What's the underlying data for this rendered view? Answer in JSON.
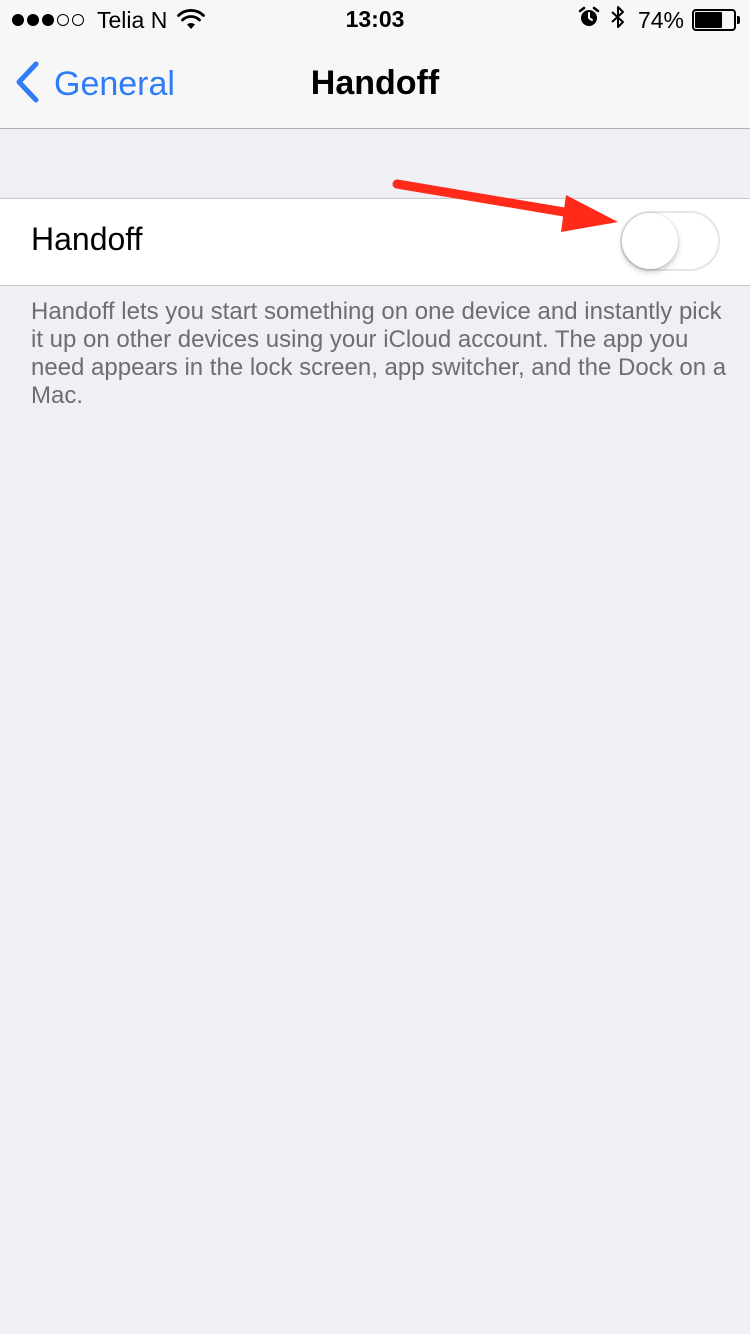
{
  "status_bar": {
    "signal_strength": "3/5",
    "carrier": "Telia N",
    "time": "13:03",
    "battery_percent": "74%",
    "battery_level": 0.74,
    "icons": [
      "wifi-icon",
      "alarm-icon",
      "bluetooth-icon",
      "battery-icon"
    ]
  },
  "nav": {
    "back_label": "General",
    "title": "Handoff"
  },
  "settings": {
    "handoff_label": "Handoff",
    "handoff_enabled": false
  },
  "footer": {
    "description": "Handoff lets you start something on one device and instantly pick it up on other devices using your iCloud account. The app you need appears in the lock screen, app switcher, and the Dock on a Mac."
  },
  "colors": {
    "accent": "#2f7cf6",
    "background": "#efeff4",
    "annotation": "#ff2a1a"
  }
}
